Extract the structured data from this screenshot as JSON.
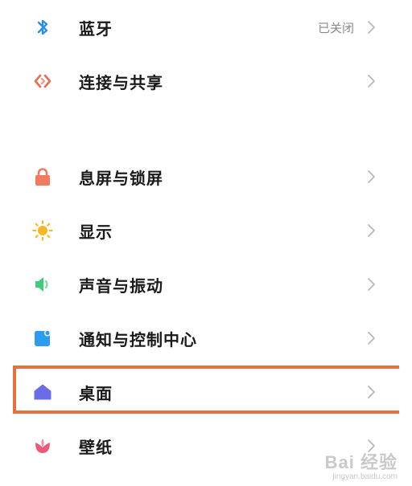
{
  "settings": {
    "items": [
      {
        "label": "蓝牙",
        "status": "已关闭",
        "icon": "bluetooth-icon",
        "color": "#2b8fe6"
      },
      {
        "label": "连接与共享",
        "status": "",
        "icon": "connection-share-icon",
        "color": "#ec6b4e"
      },
      {
        "label": "息屏与锁屏",
        "status": "",
        "icon": "lock-icon",
        "color": "#f27a61"
      },
      {
        "label": "显示",
        "status": "",
        "icon": "sun-icon",
        "color": "#f5b823"
      },
      {
        "label": "声音与振动",
        "status": "",
        "icon": "speaker-icon",
        "color": "#3fcc7a"
      },
      {
        "label": "通知与控制中心",
        "status": "",
        "icon": "notification-icon",
        "color": "#2c9cf0"
      },
      {
        "label": "桌面",
        "status": "",
        "icon": "home-icon",
        "color": "#6b6de6"
      },
      {
        "label": "壁纸",
        "status": "",
        "icon": "wallpaper-flower-icon",
        "color": "#ec5a79"
      }
    ]
  },
  "highlight": {
    "color": "#e8703a"
  },
  "watermark": {
    "main": "Bai 经验",
    "sub": "jingyan.baidu.com"
  }
}
